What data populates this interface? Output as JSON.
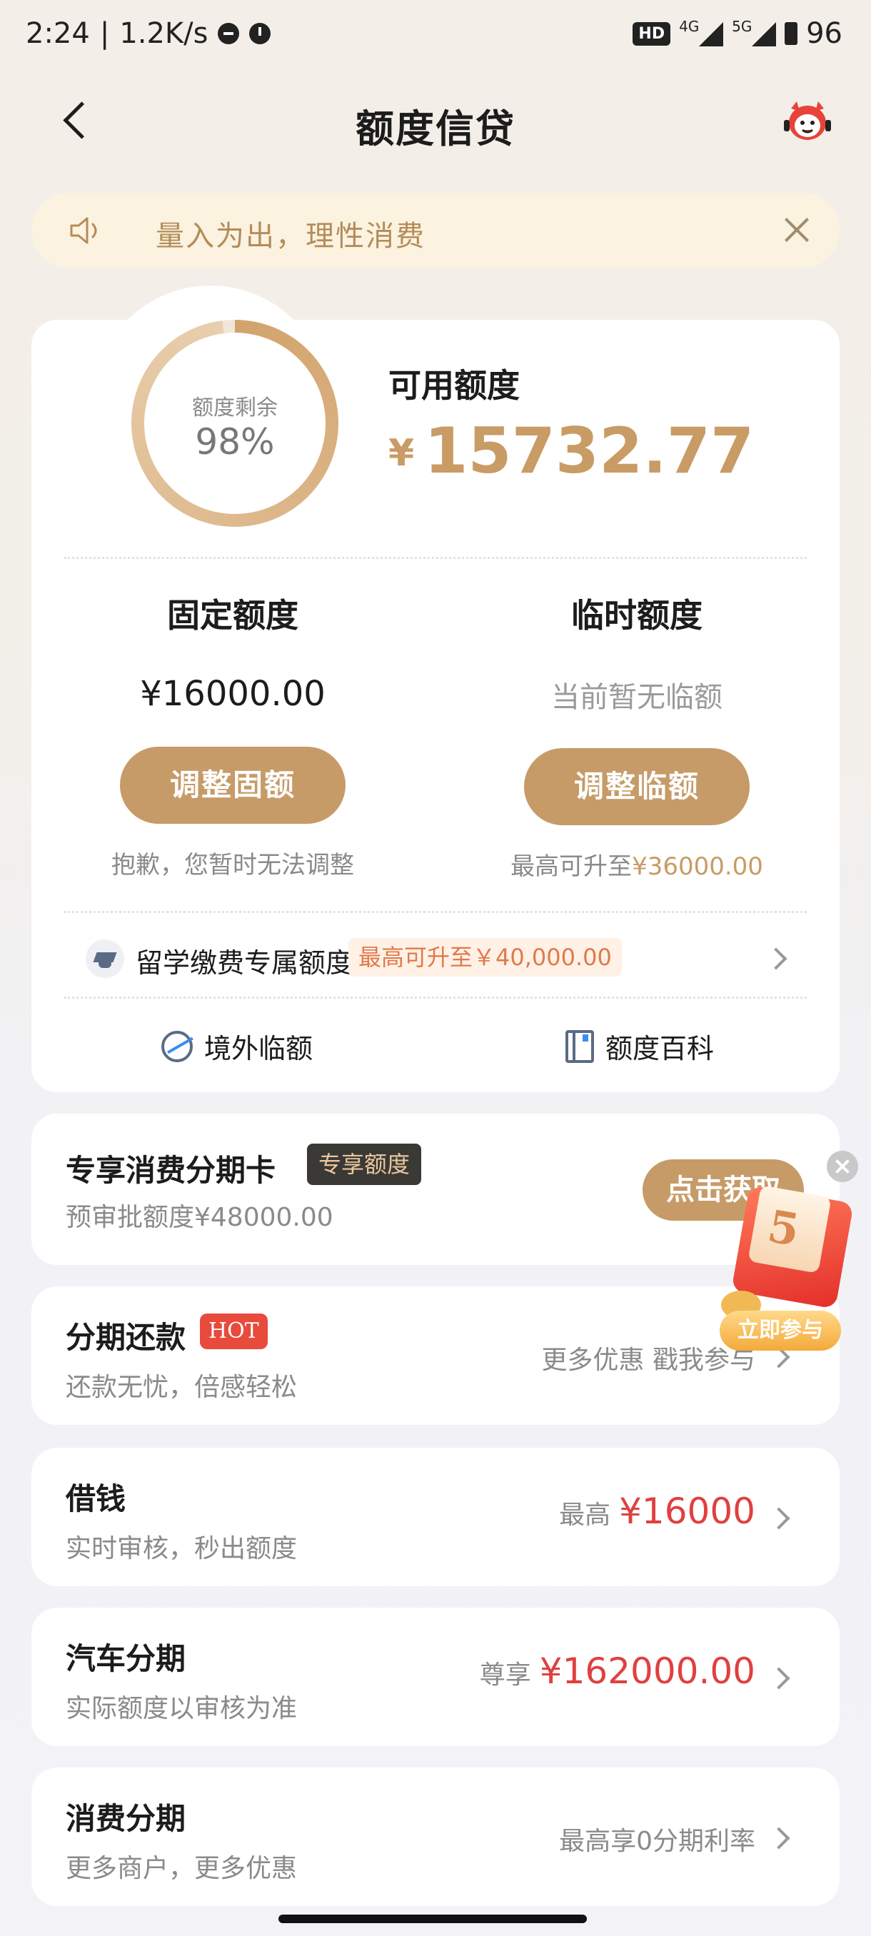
{
  "status_bar": {
    "time": "2:24",
    "speed": "1.2K/s",
    "hd": "HD",
    "net1": "4G",
    "net2": "5G",
    "battery": "96"
  },
  "header": {
    "title": "额度信贷"
  },
  "notice": {
    "text": "量入为出，理性消费"
  },
  "credit": {
    "remain_label": "额度剩余",
    "remain_percent": "98%",
    "remain_fraction": 0.98,
    "available_label": "可用额度",
    "currency": "¥",
    "available_amount": "15732.77"
  },
  "fixed": {
    "title": "固定额度",
    "value": "¥16000.00",
    "button": "调整固额",
    "note": "抱歉，您暂时无法调整"
  },
  "temp": {
    "title": "临时额度",
    "value": "当前暂无临额",
    "button": "调整临额",
    "note_prefix": "最高可升至",
    "note_amount": "¥36000.00"
  },
  "study": {
    "label": "留学缴费专属额度",
    "badge": "最高可升至￥40,000.00"
  },
  "tools": {
    "overseas": "境外临额",
    "wiki": "额度百科"
  },
  "card_offer": {
    "title": "专享消费分期卡",
    "tag": "专享额度",
    "sub": "预审批额度¥48000.00",
    "button": "点击获取"
  },
  "installment_repay": {
    "title": "分期还款",
    "tag": "HOT",
    "sub": "还款无忧，倍感轻松",
    "right": "更多优惠 戳我参与"
  },
  "borrow": {
    "title": "借钱",
    "sub": "实时审核，秒出额度",
    "right_prefix": "最高",
    "right_amount": "¥16000"
  },
  "car": {
    "title": "汽车分期",
    "sub": "实际额度以审核为准",
    "right_prefix": "尊享",
    "right_amount": "¥162000.00"
  },
  "consumer": {
    "title": "消费分期",
    "sub": "更多商户，更多优惠",
    "right": "最高享0分期利率"
  },
  "promo": {
    "digit": "5",
    "button": "立即参与"
  }
}
